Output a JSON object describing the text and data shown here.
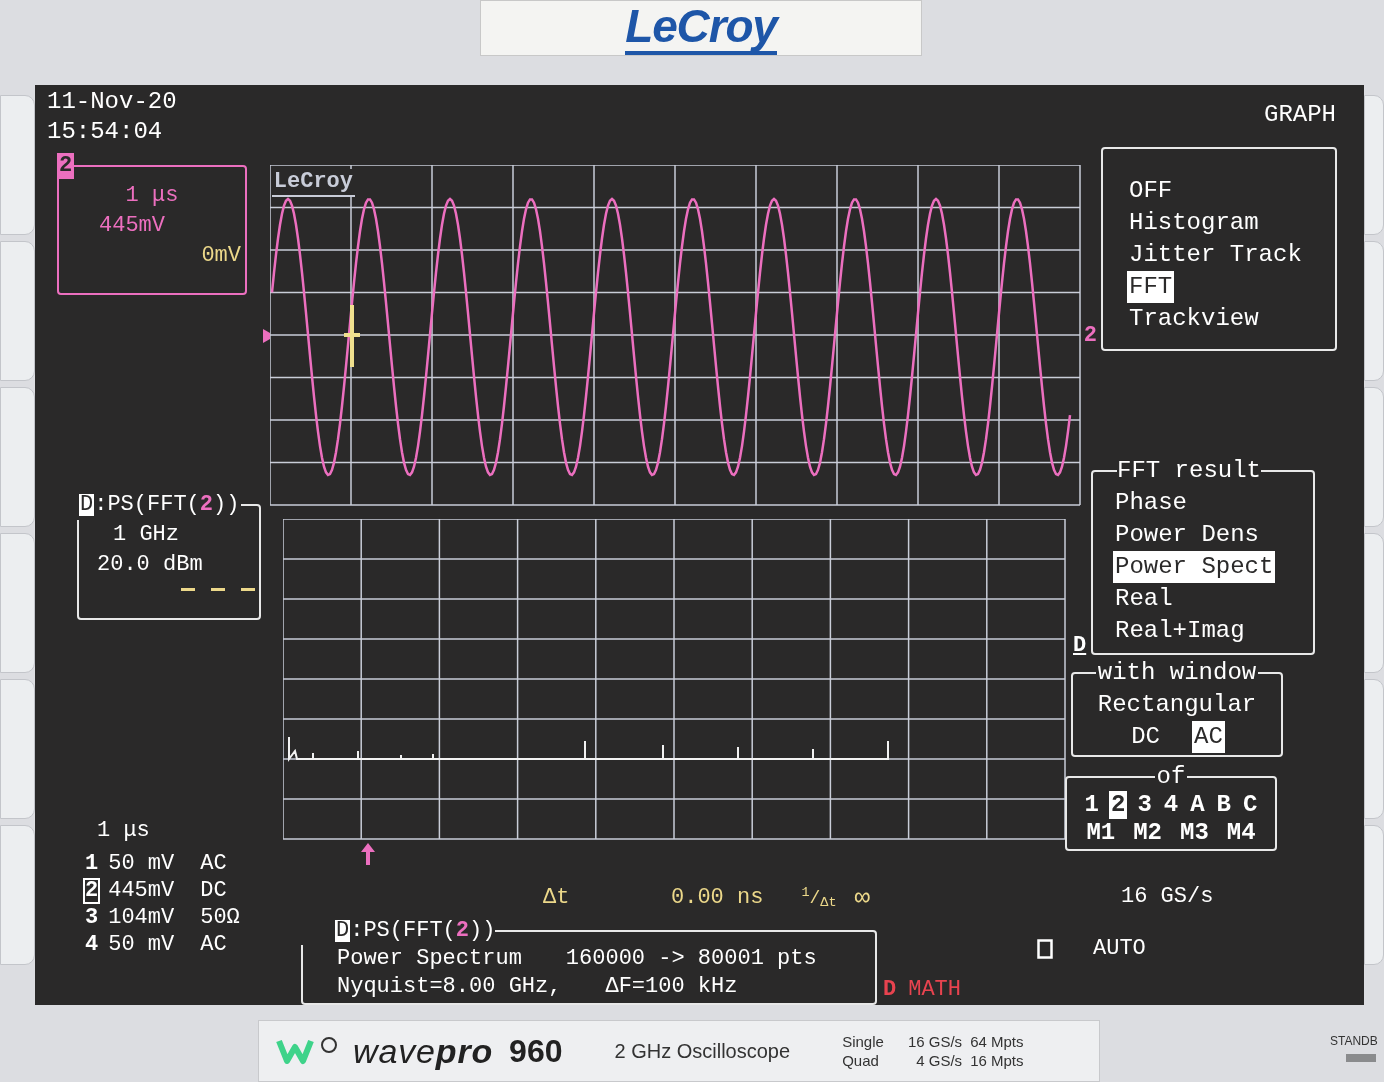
{
  "brand": "LeCroy",
  "screen": {
    "date": "11-Nov-20",
    "time": "15:54:04",
    "channel_box": {
      "channel": "2",
      "timebase": "1 μs",
      "scale": "445mV",
      "offset": "0mV"
    },
    "grid_logo": "LeCroy",
    "trace_label": "2",
    "math_trace_label": "D",
    "math_box": {
      "label": "D",
      "formula": ":PS(FFT(",
      "source": "2",
      "formula_end": "))",
      "frequency": "1 GHz",
      "scale": "20.0 dBm"
    },
    "timebase": "1 μs",
    "channels": [
      {
        "number": "1",
        "scale": "50 mV",
        "coupling": "AC",
        "selected": false
      },
      {
        "number": "2",
        "scale": "445mV",
        "coupling": "DC",
        "selected": true
      },
      {
        "number": "3",
        "scale": "104mV",
        "coupling": "50Ω",
        "selected": false
      },
      {
        "number": "4",
        "scale": "50 mV",
        "coupling": "AC",
        "selected": false
      }
    ],
    "cursor": {
      "delta_label": "Δt",
      "delta_value": "0.00 ns",
      "inverse_label": "$^{1}$/$_{Δt}$",
      "inverse_value": "∞"
    },
    "math_info": {
      "label": "D",
      "formula": ":PS(FFT(",
      "source": "2",
      "formula_end": "))",
      "function": "Power Spectrum",
      "points": "160000 -> 80001 pts",
      "nyquist": "Nyquist=8.00 GHz,",
      "resolution": "ΔF=100 kHz"
    },
    "status": {
      "trace": "D",
      "mode": "MATH",
      "sample_rate": "16 GS/s",
      "trigger": "AUTO"
    },
    "graph_menu": {
      "title": "GRAPH",
      "items": [
        {
          "label": "OFF",
          "selected": false
        },
        {
          "label": "Histogram",
          "selected": false
        },
        {
          "label": "Jitter Track",
          "selected": false
        },
        {
          "label": "FFT",
          "selected": true
        },
        {
          "label": "Trackview",
          "selected": false
        }
      ]
    },
    "fft_result": {
      "title": "FFT result",
      "items": [
        {
          "label": "Phase",
          "selected": false
        },
        {
          "label": "Power Dens",
          "selected": false
        },
        {
          "label": "Power Spect",
          "selected": true
        },
        {
          "label": "Real",
          "selected": false
        },
        {
          "label": "Real+Imag",
          "selected": false
        }
      ]
    },
    "window_menu": {
      "title": "with window",
      "value": "Rectangular",
      "options": [
        {
          "label": "DC",
          "selected": false
        },
        {
          "label": "AC",
          "selected": true
        }
      ]
    },
    "source_menu": {
      "title": "of",
      "sources": [
        {
          "label": "1",
          "selected": false
        },
        {
          "label": "2",
          "selected": true
        },
        {
          "label": "3",
          "selected": false
        },
        {
          "label": "4",
          "selected": false
        },
        {
          "label": "A",
          "selected": false
        },
        {
          "label": "B",
          "selected": false
        },
        {
          "label": "C",
          "selected": false
        }
      ],
      "memories": [
        {
          "label": "M1",
          "selected": false
        },
        {
          "label": "M2",
          "selected": false
        },
        {
          "label": "M3",
          "selected": false
        },
        {
          "label": "M4",
          "selected": false
        }
      ]
    }
  },
  "badge": {
    "series": "wave**pro**",
    "model": "960",
    "description": "2 GHz Oscilloscope",
    "specs": [
      {
        "mode": "Single",
        "rate": "16 GS/s",
        "memory": "64 Mpts"
      },
      {
        "mode": "Quad",
        "rate": "4 GS/s",
        "memory": "16 Mpts"
      }
    ],
    "standby": "STANDB"
  }
}
